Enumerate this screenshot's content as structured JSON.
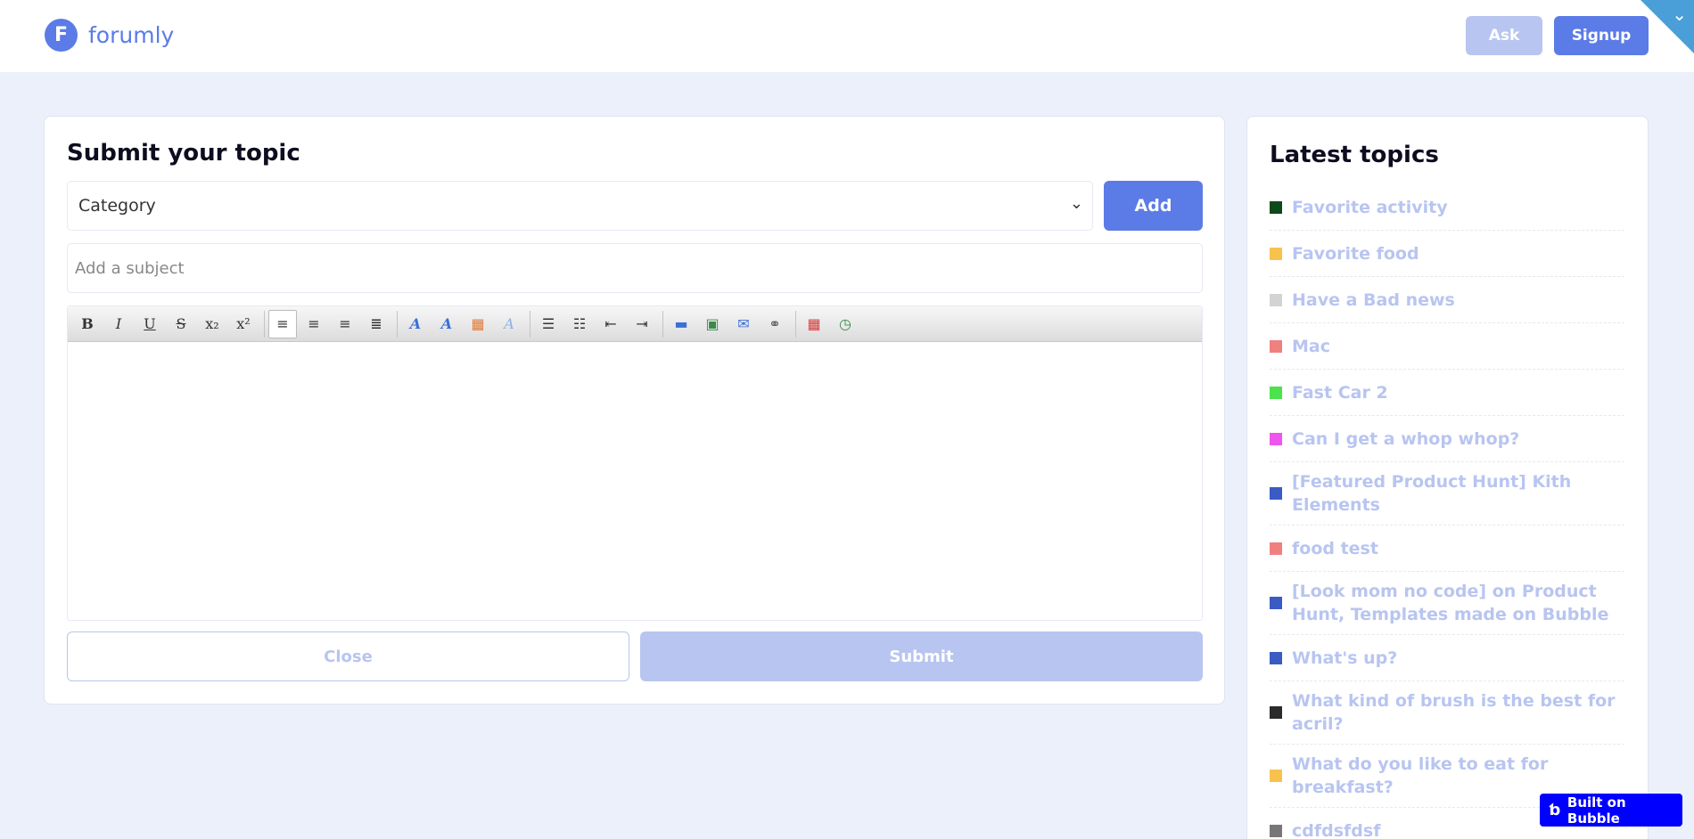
{
  "header": {
    "logo_letter": "F",
    "logo_text": "forumly",
    "ask_label": "Ask",
    "signup_label": "Signup"
  },
  "form": {
    "title": "Submit your topic",
    "category_value": "Category",
    "add_label": "Add",
    "subject_placeholder": "Add a subject",
    "close_label": "Close",
    "submit_label": "Submit"
  },
  "toolbar": {
    "groups": [
      [
        "bold-icon",
        "italic-icon",
        "underline-icon",
        "strikethrough-icon",
        "subscript-icon",
        "superscript-icon"
      ],
      [
        "align-left-icon",
        "align-center-icon",
        "align-right-icon",
        "justify-icon"
      ],
      [
        "font-family-icon",
        "font-size-icon",
        "text-color-icon",
        "clear-format-icon"
      ],
      [
        "bullet-list-icon",
        "numbered-list-icon",
        "outdent-icon",
        "indent-icon"
      ],
      [
        "horizontal-rule-icon",
        "insert-image-icon",
        "insert-email-icon",
        "insert-link-icon"
      ],
      [
        "insert-date-icon",
        "insert-time-icon"
      ]
    ]
  },
  "sidebar": {
    "title": "Latest topics",
    "topics": [
      {
        "label": "Favorite activity",
        "color": "#0b4a1a"
      },
      {
        "label": "Favorite food",
        "color": "#f7c34c"
      },
      {
        "label": "Have a Bad news",
        "color": "#d3d3d3"
      },
      {
        "label": "Mac",
        "color": "#f08080"
      },
      {
        "label": "Fast Car 2",
        "color": "#4be24b"
      },
      {
        "label": "Can I get a whop whop?",
        "color": "#ee55ee"
      },
      {
        "label": "[Featured Product Hunt] Kith Elements",
        "color": "#3a5bc4"
      },
      {
        "label": "food test",
        "color": "#f08080"
      },
      {
        "label": "[Look mom no code] on Product Hunt, Templates made on Bubble",
        "color": "#3a5bc4"
      },
      {
        "label": "What's up?",
        "color": "#3a5bc4"
      },
      {
        "label": "What kind of brush is the best for acril?",
        "color": "#2b2b2b"
      },
      {
        "label": "What do you like to eat for breakfast?",
        "color": "#f7c34c"
      },
      {
        "label": "cdfdsfdsf",
        "color": "#777777"
      }
    ]
  },
  "badge": {
    "label": "Built on Bubble"
  }
}
